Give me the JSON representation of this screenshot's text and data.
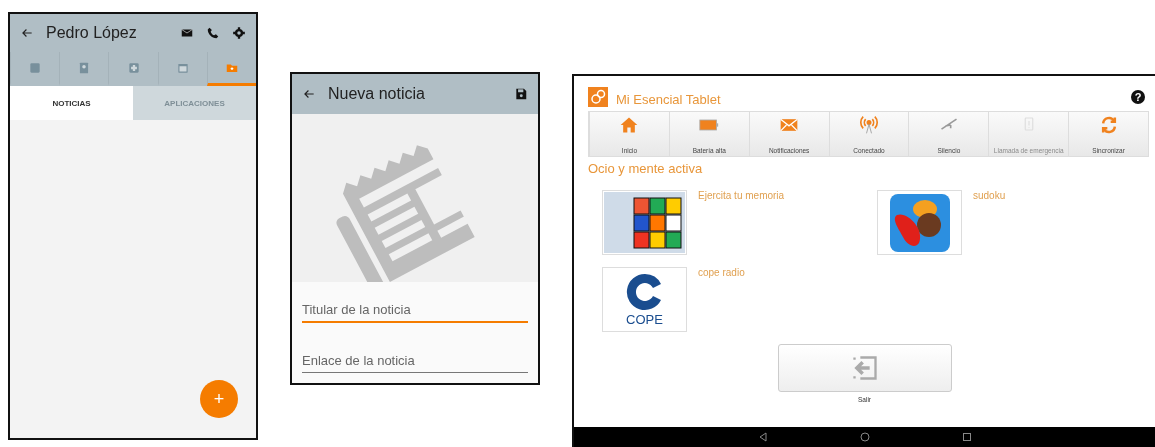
{
  "contact_screen": {
    "title": "Pedro López",
    "icon_tabs": [
      {
        "kind": "card",
        "selected": false
      },
      {
        "kind": "contact",
        "selected": false
      },
      {
        "kind": "medical",
        "selected": false
      },
      {
        "kind": "calendar",
        "selected": false
      },
      {
        "kind": "folder",
        "selected": true
      }
    ],
    "sub_tabs": [
      {
        "label": "NOTICIAS",
        "selected": true
      },
      {
        "label": "APLICACIONES",
        "selected": false
      }
    ],
    "fab": "+"
  },
  "news_screen": {
    "title": "Nueva noticia",
    "fields": [
      {
        "placeholder": "Titular de la noticia",
        "focused": true
      },
      {
        "placeholder": "Enlace de la noticia",
        "focused": false
      }
    ]
  },
  "tablet_screen": {
    "title": "Mi Esencial Tablet",
    "help": "?",
    "status_items": [
      {
        "kind": "home",
        "label": "Inicio",
        "disabled": false
      },
      {
        "kind": "battery",
        "label": "Batería alta",
        "disabled": false
      },
      {
        "kind": "mail",
        "label": "Notificaciones",
        "disabled": false
      },
      {
        "kind": "signal",
        "label": "Conectado",
        "disabled": false
      },
      {
        "kind": "silent",
        "label": "Silencio",
        "disabled": false
      },
      {
        "kind": "emergency",
        "label": "Llamada de emergencia",
        "disabled": true
      },
      {
        "kind": "sync",
        "label": "Sincronizar",
        "disabled": false
      }
    ],
    "section": "Ocio y mente activa",
    "apps": [
      {
        "kind": "cube",
        "name": "Ejercita tu memoria"
      },
      {
        "kind": "candy",
        "name": "sudoku"
      },
      {
        "kind": "radio",
        "name": "cope radio",
        "logo_text": "COPE"
      }
    ],
    "exit_label": "Salir"
  }
}
